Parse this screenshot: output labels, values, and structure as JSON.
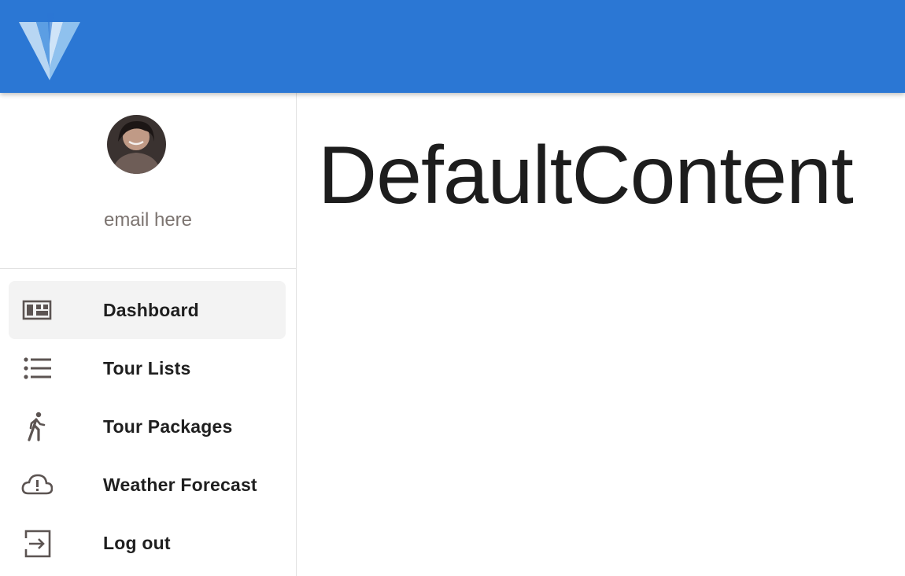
{
  "app_bar": {
    "logo_icon": "vuetify-logo-icon",
    "color": "#2b77d4"
  },
  "profile": {
    "avatar_icon": "user-avatar",
    "email": "email here"
  },
  "nav": {
    "items": [
      {
        "label": "Dashboard",
        "icon": "dashboard-icon",
        "active": true
      },
      {
        "label": "Tour Lists",
        "icon": "list-icon",
        "active": false
      },
      {
        "label": "Tour Packages",
        "icon": "walk-icon",
        "active": false
      },
      {
        "label": "Weather Forecast",
        "icon": "cloud-alert-icon",
        "active": false
      },
      {
        "label": "Log out",
        "icon": "exit-icon",
        "active": false
      }
    ]
  },
  "main": {
    "title": "DefaultContent"
  }
}
